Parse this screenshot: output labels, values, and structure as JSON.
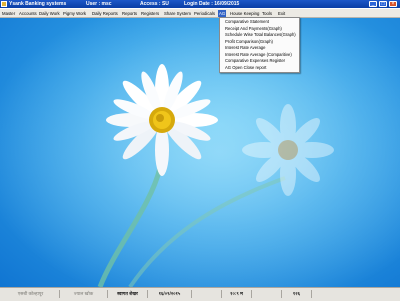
{
  "titlebar": {
    "title": "Ysank Banking systems",
    "user": "User : msc",
    "access": "Access  :  SU",
    "login_date": "Login Date :  16/09/2015",
    "minimize": "_",
    "maximize": "□",
    "close": "×"
  },
  "menu": [
    {
      "label": "Master"
    },
    {
      "label": "Accounts"
    },
    {
      "label": "Daily Work"
    },
    {
      "label": "Pigmy Work"
    },
    {
      "label": "Daily Reports"
    },
    {
      "label": "Reports"
    },
    {
      "label": "Registers"
    },
    {
      "label": "Share System"
    },
    {
      "label": "Periodicals"
    },
    {
      "label": "AG"
    },
    {
      "label": "House Keeping"
    },
    {
      "label": "Tools"
    },
    {
      "label": "Exit"
    }
  ],
  "dropdown": [
    {
      "label": "Comparative Statement"
    },
    {
      "label": "Receipt And Payments(Graph)"
    },
    {
      "label": "Schedule Wise Total Balances(Graph)"
    },
    {
      "label": "Profit Comparison(Graph)"
    },
    {
      "label": "Interest Rate Average"
    },
    {
      "label": "Interest Rate Average (Comparitive)"
    },
    {
      "label": "Comparative Expenses Register"
    },
    {
      "label": "AG Open Close report"
    }
  ],
  "statusbar": {
    "cells": [
      {
        "text": "एसबी कोल्हापूर"
      },
      {
        "text": "ज्याल खोक"
      },
      {
        "text": "स्वागत शेखर"
      },
      {
        "text": "१६/०९/२०१५"
      },
      {
        "text": ""
      },
      {
        "text": "१०:९ म"
      },
      {
        "text": ""
      },
      {
        "text": "१२६"
      }
    ]
  },
  "colors": {
    "title_bar": "#0a3ea6",
    "menu_highlight": "#3162c5",
    "desktop_blue": "#2f9ee6",
    "close_button": "#d8532b"
  }
}
